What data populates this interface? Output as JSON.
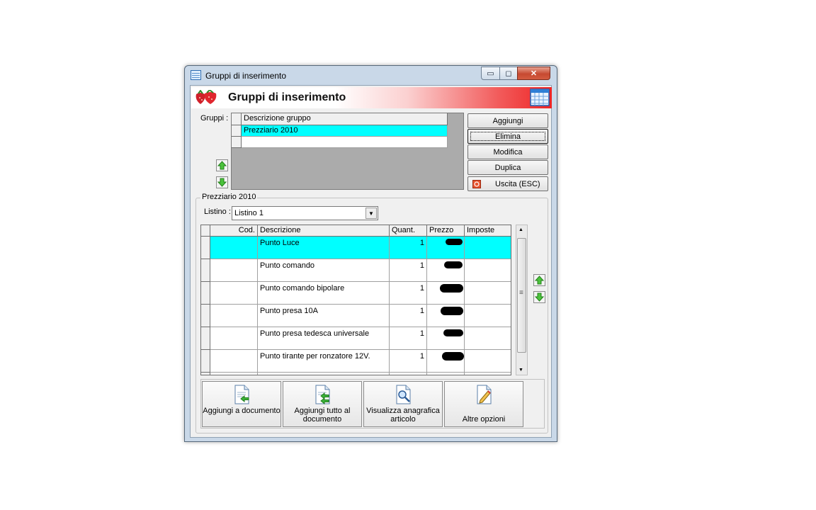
{
  "window": {
    "title": "Gruppi di inserimento",
    "caption_buttons": {
      "minimize": "▭",
      "maximize": "◻",
      "close": "✕"
    }
  },
  "header": {
    "title": "Gruppi di inserimento"
  },
  "gruppi": {
    "label": "Gruppi :",
    "column": "Descrizione gruppo",
    "rows": [
      "Prezziario 2010",
      ""
    ],
    "selected_index": 0
  },
  "side_buttons": {
    "aggiungi": "Aggiungi",
    "elimina": "Elimina",
    "modifica": "Modifica",
    "duplica": "Duplica",
    "uscita": "Uscita (ESC)"
  },
  "groupbox": {
    "title": "Prezziario 2010"
  },
  "listino": {
    "label": "Listino :",
    "value": "Listino 1"
  },
  "items": {
    "columns": {
      "cod": "Cod.",
      "descrizione": "Descrizione",
      "quant": "Quant.",
      "prezzo": "Prezzo",
      "imposte": "Imposte"
    },
    "rows": [
      {
        "cod": "",
        "descrizione": "Punto Luce",
        "quant": "1",
        "imposte": ""
      },
      {
        "cod": "",
        "descrizione": "Punto comando",
        "quant": "1",
        "imposte": ""
      },
      {
        "cod": "",
        "descrizione": "Punto comando bipolare",
        "quant": "1",
        "imposte": ""
      },
      {
        "cod": "",
        "descrizione": "Punto presa 10A",
        "quant": "1",
        "imposte": ""
      },
      {
        "cod": "",
        "descrizione": "Punto presa tedesca universale",
        "quant": "1",
        "imposte": ""
      },
      {
        "cod": "",
        "descrizione": "Punto tirante per ronzatore 12V.",
        "quant": "1",
        "imposte": ""
      }
    ],
    "selected_index": 0,
    "scroll_grip": "≡"
  },
  "actions": {
    "aggiungi_documento": "Aggiungi a documento",
    "aggiungi_tutto": "Aggiungi tutto al documento",
    "visualizza": "Visualizza anagrafica articolo",
    "altre_opzioni": "Altre opzioni"
  },
  "colors": {
    "selected_row": "#00ffff",
    "banner_red": "#ee2424"
  }
}
